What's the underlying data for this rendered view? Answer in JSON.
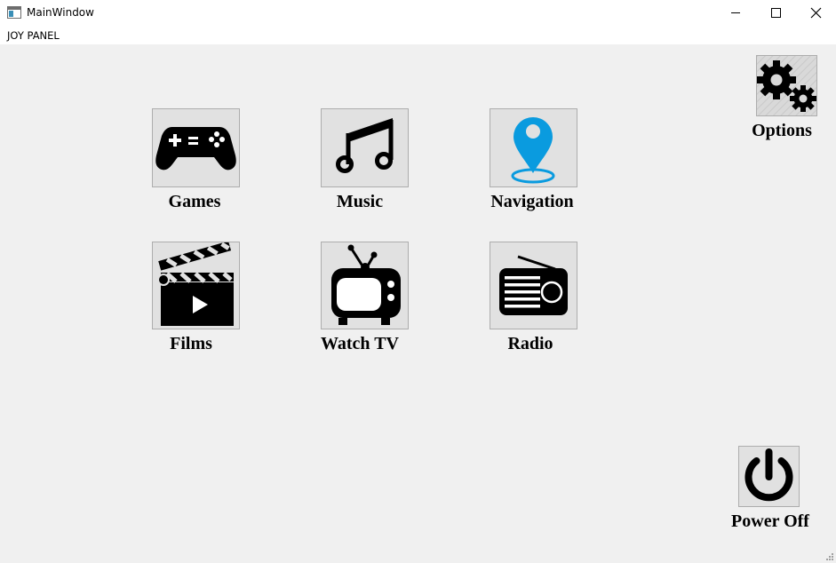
{
  "window": {
    "title": "MainWindow"
  },
  "menu": {
    "items": [
      {
        "label": "JOY PANEL"
      }
    ]
  },
  "apps": [
    {
      "label": "Games",
      "icon": "gamepad-icon"
    },
    {
      "label": "Music",
      "icon": "music-note-icon"
    },
    {
      "label": "Navigation",
      "icon": "map-pin-icon"
    },
    {
      "label": "Films",
      "icon": "clapperboard-icon"
    },
    {
      "label": "Watch TV",
      "icon": "tv-icon"
    },
    {
      "label": "Radio",
      "icon": "radio-icon"
    }
  ],
  "options": {
    "label": "Options",
    "icon": "gears-icon"
  },
  "power": {
    "label": "Power Off",
    "icon": "power-icon"
  },
  "colors": {
    "accent": "#0a9bdf",
    "background": "#f0f0f0",
    "tile": "#e1e1e1"
  }
}
